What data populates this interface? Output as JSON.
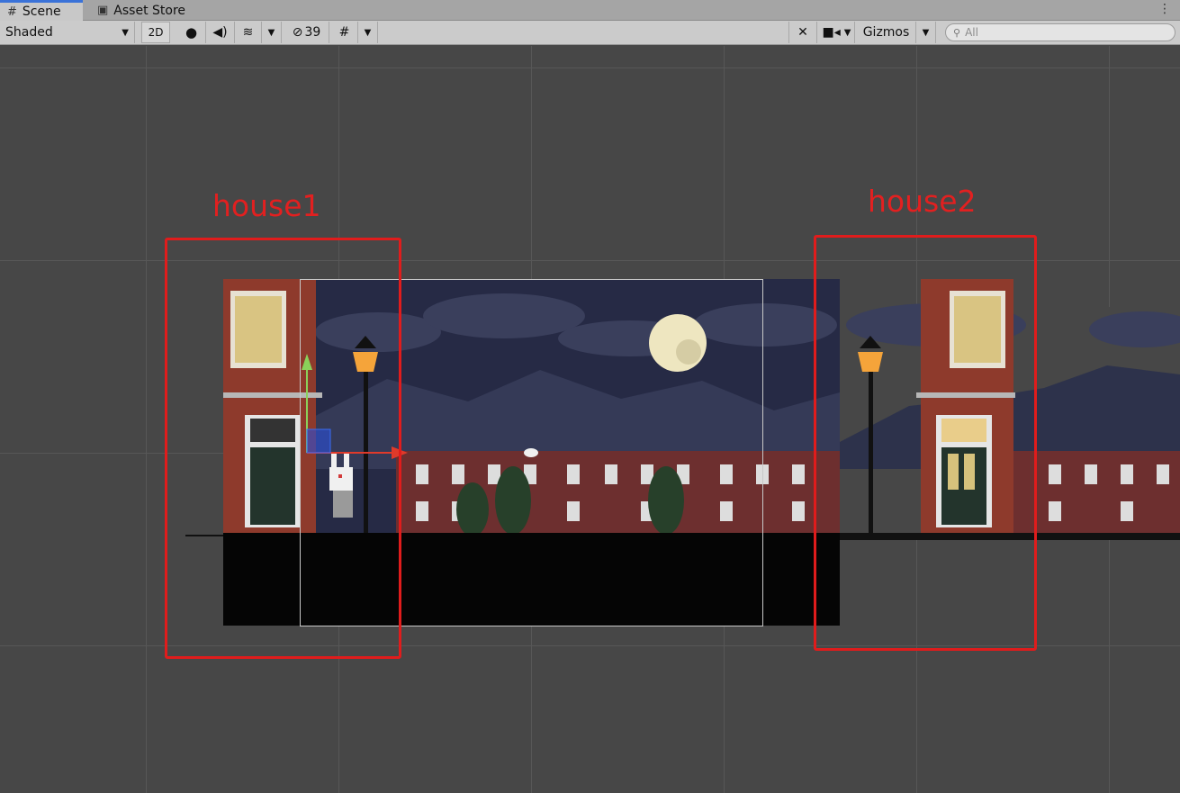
{
  "tabs": {
    "scene": "Scene",
    "asset_store": "Asset Store"
  },
  "toolbar": {
    "draw_mode": "Shaded",
    "mode_2d": "2D",
    "hidden_count": "39",
    "gizmos": "Gizmos",
    "search_placeholder": "All"
  },
  "annotations": {
    "house1": "house1",
    "house2": "house2"
  },
  "colors": {
    "annotation": "#e01c1c",
    "sky": "#262a45",
    "brick": "#8e3a2c",
    "ground": "#050505"
  }
}
